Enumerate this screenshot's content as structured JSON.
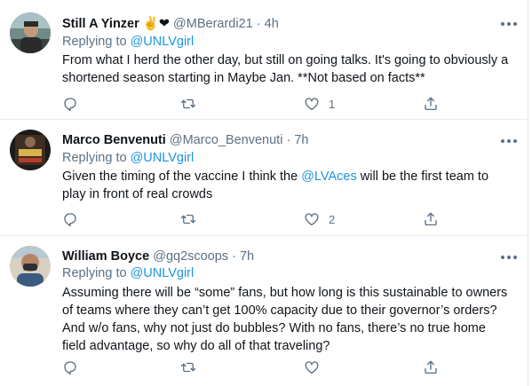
{
  "tweets": [
    {
      "name": "Still A Yinzer",
      "emoji": "✌️❤",
      "handle": "@MBerardi21",
      "dot": "·",
      "time": "4h",
      "replying_prefix": "Replying to",
      "replying_to": "@UNLVgirl",
      "text": "From what I herd the other day, but still on going talks. It's going to obviously a shortened season starting in Maybe Jan.  **Not based on facts**",
      "likes": "1"
    },
    {
      "name": "Marco Benvenuti",
      "handle": "@Marco_Benvenuti",
      "dot": "·",
      "time": "7h",
      "replying_prefix": "Replying to",
      "replying_to": "@UNLVgirl",
      "text_before": "Given the timing of the vaccine I think the ",
      "text_mention": "@LVAces",
      "text_after": " will be the first team to play in front of real crowds",
      "likes": "2"
    },
    {
      "name": "William Boyce",
      "handle": "@gq2scoops",
      "dot": "·",
      "time": "7h",
      "replying_prefix": "Replying to",
      "replying_to": "@UNLVgirl",
      "text": "Assuming there will be “some” fans, but how long is this sustainable to owners of teams where they can’t get 100% capacity due to their governor’s orders?  And w/o fans, why not just do bubbles?  With no fans, there’s no true home field advantage, so why do all of that traveling?"
    }
  ],
  "colors": {
    "accent": "#1b95e0",
    "muted": "#5b7083",
    "text": "#0f1419",
    "divider": "#e6ecf0"
  },
  "icons": [
    "reply-icon",
    "retweet-icon",
    "like-icon",
    "share-icon",
    "more-icon"
  ]
}
